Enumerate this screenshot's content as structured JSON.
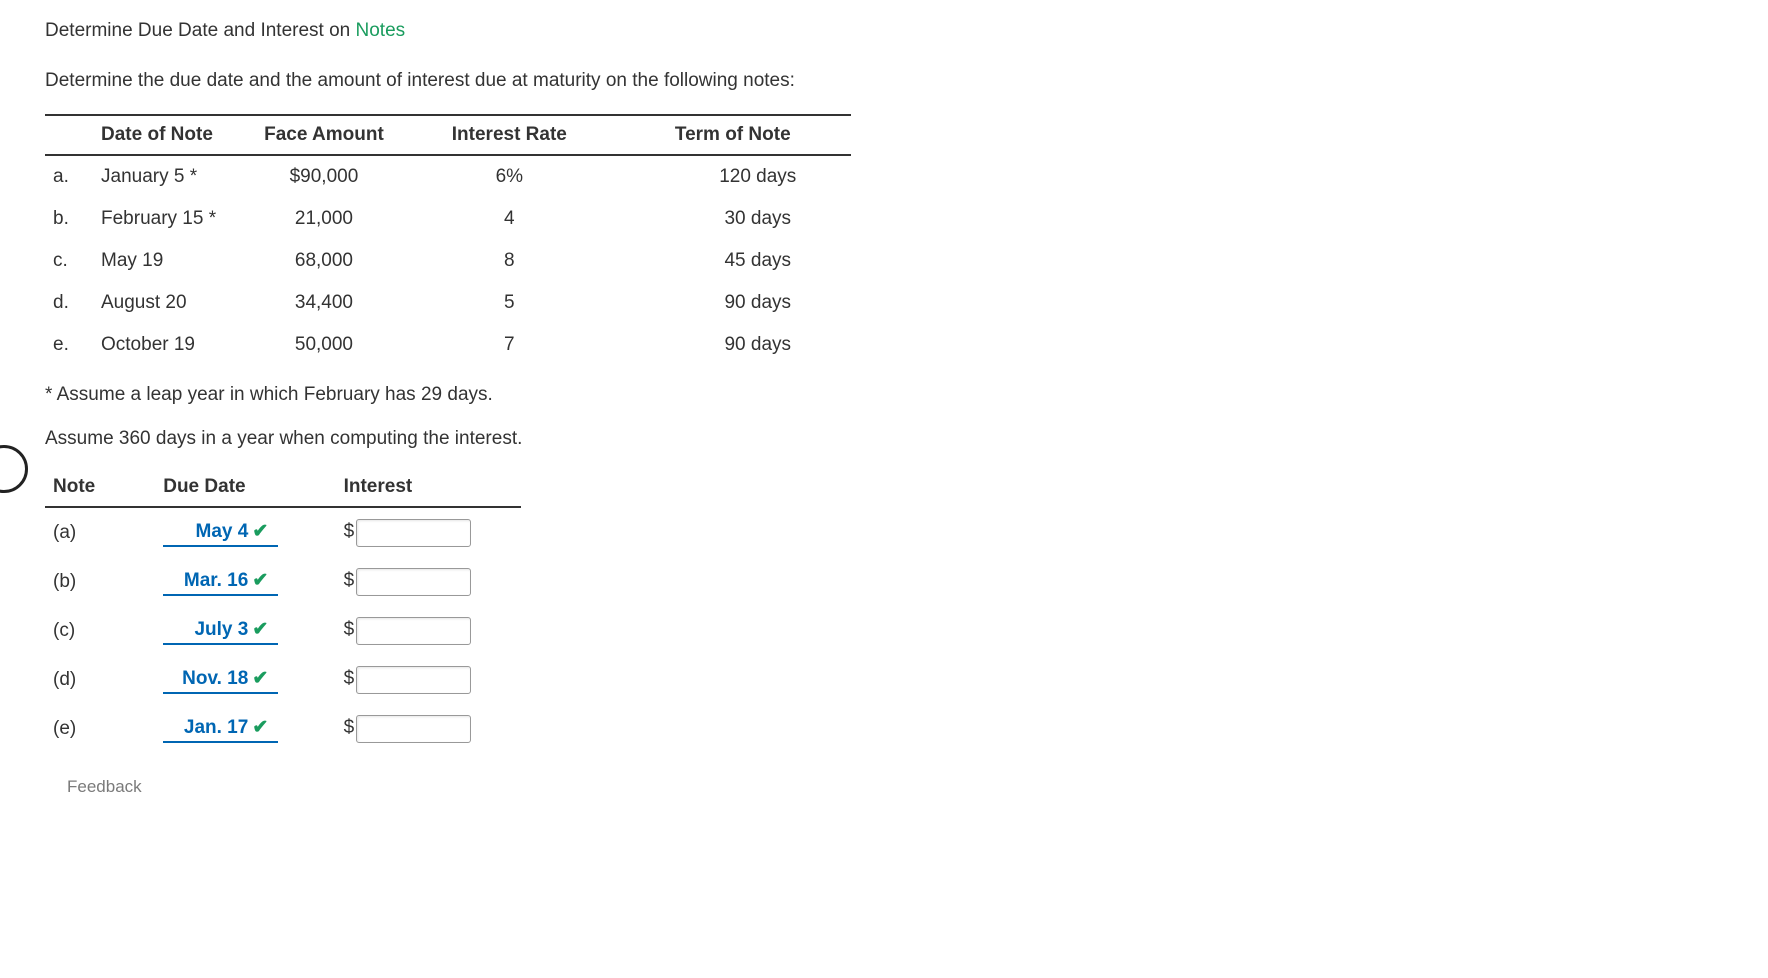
{
  "title": {
    "pre": "Determine Due Date and Interest on ",
    "link": "Notes"
  },
  "instruction": "Determine the due date and the amount of interest due at maturity on the following notes:",
  "notes_table": {
    "headers": {
      "date": "Date of Note",
      "face": "Face Amount",
      "rate": "Interest Rate",
      "term": "Term of Note"
    },
    "rows": [
      {
        "letter": "a.",
        "date": "January 5 *",
        "face": "$90,000",
        "rate": "6%",
        "term": "120 days"
      },
      {
        "letter": "b.",
        "date": "February 15 *",
        "face": "21,000",
        "rate": "4",
        "term": "30 days"
      },
      {
        "letter": "c.",
        "date": "May 19",
        "face": "68,000",
        "rate": "8",
        "term": "45 days"
      },
      {
        "letter": "d.",
        "date": "August 20",
        "face": "34,400",
        "rate": "5",
        "term": "90 days"
      },
      {
        "letter": "e.",
        "date": "October 19",
        "face": "50,000",
        "rate": "7",
        "term": "90 days"
      }
    ]
  },
  "footnote": "* Assume a leap year in which February has 29 days.",
  "assumption": "Assume 360 days in a year when computing the interest.",
  "answer_table": {
    "headers": {
      "note": "Note",
      "due": "Due Date",
      "interest": "Interest"
    },
    "rows": [
      {
        "note": "(a)",
        "due": "May 4",
        "dollar": "$",
        "interest": ""
      },
      {
        "note": "(b)",
        "due": "Mar. 16",
        "dollar": "$",
        "interest": ""
      },
      {
        "note": "(c)",
        "due": "July 3",
        "dollar": "$",
        "interest": ""
      },
      {
        "note": "(d)",
        "due": "Nov. 18",
        "dollar": "$",
        "interest": ""
      },
      {
        "note": "(e)",
        "due": "Jan. 17",
        "dollar": "$",
        "interest": ""
      }
    ]
  },
  "feedback_label": "Feedback"
}
